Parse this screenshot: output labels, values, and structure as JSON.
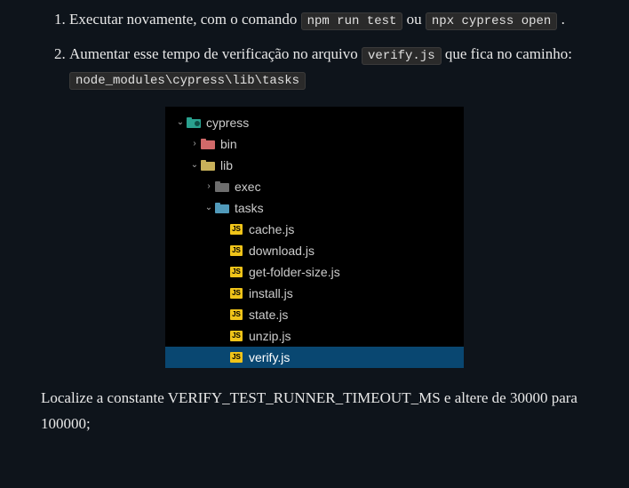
{
  "list": {
    "item1_a": "Executar novamente, com o comando ",
    "item1_code1": "npm run test",
    "item1_b": " ou ",
    "item1_code2": "npx cypress open",
    "item1_c": ".",
    "item2_a": "Aumentar esse tempo de verificação no arquivo ",
    "item2_code1": "verify.js",
    "item2_b": " que fica no caminho: ",
    "item2_code2": "node_modules\\cypress\\lib\\tasks"
  },
  "tree": {
    "cypress": "cypress",
    "bin": "bin",
    "lib": "lib",
    "exec": "exec",
    "tasks": "tasks",
    "files": [
      "cache.js",
      "download.js",
      "get-folder-size.js",
      "install.js",
      "state.js",
      "unzip.js",
      "verify.js"
    ],
    "js_badge": "JS"
  },
  "post": "Localize a constante VERIFY_TEST_RUNNER_TIMEOUT_MS e altere de 30000 para 100000;"
}
